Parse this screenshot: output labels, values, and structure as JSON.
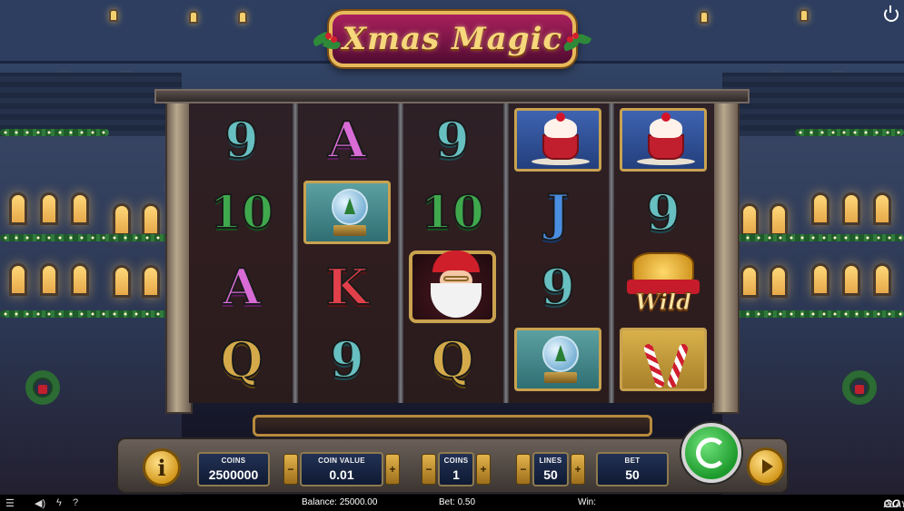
{
  "game": {
    "title": "Xmas Magic",
    "reels": [
      [
        "9",
        "10",
        "A",
        "Q"
      ],
      [
        "A",
        "snowglobe",
        "K",
        "9"
      ],
      [
        "9",
        "10",
        "santa",
        "Q"
      ],
      [
        "cupcake",
        "J",
        "9",
        "snowglobe"
      ],
      [
        "cupcake",
        "9",
        "wild",
        "candycane"
      ]
    ],
    "wild_label": "Wild"
  },
  "controls": {
    "info_label": "i",
    "coins": {
      "label": "COINS",
      "value": "2500000"
    },
    "coin_value": {
      "label": "COIN VALUE",
      "value": "0.01"
    },
    "bet_coins": {
      "label": "COINS",
      "value": "1"
    },
    "lines": {
      "label": "LINES",
      "value": "50"
    },
    "bet": {
      "label": "BET",
      "value": "50"
    },
    "minus": "−",
    "plus": "+"
  },
  "status": {
    "balance": "Balance: 25000.00",
    "bet": "Bet: 0.50",
    "win": "Win:",
    "brand_prefix": "PLAY'N",
    "brand_suffix": "GO"
  },
  "icons": [
    "menu-icon",
    "sound-icon",
    "turbo-icon",
    "help-icon",
    "power-icon",
    "spin-icon",
    "autoplay-icon"
  ],
  "colors": {
    "spin": "#1d9a2c",
    "accent_gold": "#d49a1e",
    "logo": "#a8205c"
  }
}
